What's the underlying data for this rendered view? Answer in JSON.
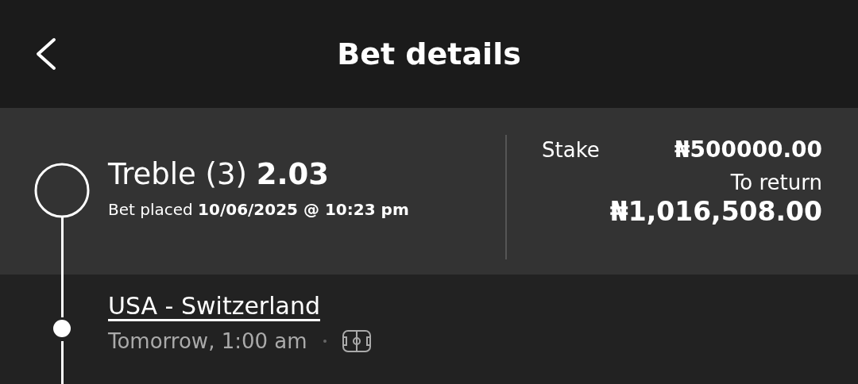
{
  "header": {
    "title": "Bet details"
  },
  "summary": {
    "title": "Treble (3) **2.03**",
    "placed": "Bet placed **10/06/2025 @ 10:23 pm**",
    "stake_label": "Stake",
    "stake": "₦500000.00",
    "return_label": "To return",
    "return": "₦1,016,508.00"
  },
  "events": [
    {
      "name": "USA - Switzerland",
      "time": "Tomorrow, 1:00 am"
    }
  ]
}
